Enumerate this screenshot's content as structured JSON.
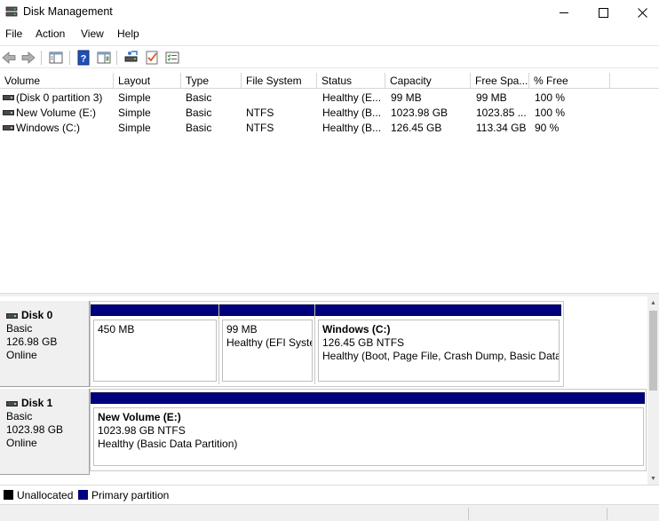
{
  "window": {
    "title": "Disk Management"
  },
  "menu": [
    "File",
    "Action",
    "View",
    "Help"
  ],
  "toolbar": {
    "buttons": [
      "back-icon",
      "forward-icon",
      "console-tree-icon",
      "help-icon",
      "show-hide-icon",
      "connect-disk-icon",
      "check-icon",
      "properties-icon"
    ]
  },
  "volume_list": {
    "columns": [
      "Volume",
      "Layout",
      "Type",
      "File System",
      "Status",
      "Capacity",
      "Free Spa...",
      "% Free"
    ],
    "rows": [
      [
        "(Disk 0 partition 3)",
        "Simple",
        "Basic",
        "",
        "Healthy (E...",
        "99 MB",
        "99 MB",
        "100 %"
      ],
      [
        "New Volume (E:)",
        "Simple",
        "Basic",
        "NTFS",
        "Healthy (B...",
        "1023.98 GB",
        "1023.85 ...",
        "100 %"
      ],
      [
        "Windows (C:)",
        "Simple",
        "Basic",
        "NTFS",
        "Healthy (B...",
        "126.45 GB",
        "113.34 GB",
        "90 %"
      ]
    ]
  },
  "disks": [
    {
      "name": "Disk 0",
      "type": "Basic",
      "size": "126.98 GB",
      "state": "Online",
      "partitions": [
        {
          "name": "",
          "size": "450 MB",
          "status": ""
        },
        {
          "name": "",
          "size": "99 MB",
          "status": "Healthy (EFI Syste"
        },
        {
          "name": "Windows  (C:)",
          "size": "126.45 GB NTFS",
          "status": "Healthy (Boot, Page File, Crash Dump, Basic Data"
        }
      ]
    },
    {
      "name": "Disk 1",
      "type": "Basic",
      "size": "1023.98 GB",
      "state": "Online",
      "partitions": [
        {
          "name": "New Volume  (E:)",
          "size": "1023.98 GB NTFS",
          "status": "Healthy (Basic Data Partition)"
        }
      ]
    }
  ],
  "legend": [
    {
      "label": "Unallocated",
      "color": "#000000"
    },
    {
      "label": "Primary partition",
      "color": "#00007f"
    }
  ]
}
